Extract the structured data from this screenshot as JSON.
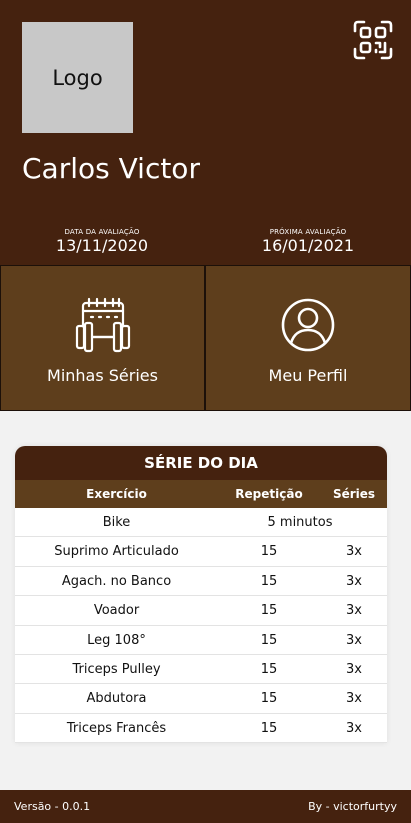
{
  "header": {
    "logo_text": "Logo",
    "user_name": "Carlos Victor",
    "evaluation_date_label": "DATA DA AVALIAÇÃO",
    "evaluation_date": "13/11/2020",
    "next_evaluation_label": "PRÓXIMA AVALIAÇÃO",
    "next_evaluation_date": "16/01/2021",
    "qr_icon": "qr-code-icon"
  },
  "tiles": {
    "series_label": "Minhas Séries",
    "series_icon": "calendar-dumbbell-icon",
    "profile_label": "Meu Perfil",
    "profile_icon": "user-profile-icon"
  },
  "series_card": {
    "title": "SÉRIE DO DIA",
    "columns": [
      "Exercício",
      "Repetição",
      "Séries"
    ],
    "rows": [
      {
        "exercise": "Bike",
        "span": "5 minutos"
      },
      {
        "exercise": "Suprimo Articulado",
        "reps": "15",
        "sets": "3x"
      },
      {
        "exercise": "Agach. no Banco",
        "reps": "15",
        "sets": "3x"
      },
      {
        "exercise": "Voador",
        "reps": "15",
        "sets": "3x"
      },
      {
        "exercise": "Leg 108°",
        "reps": "15",
        "sets": "3x"
      },
      {
        "exercise": "Triceps Pulley",
        "reps": "15",
        "sets": "3x"
      },
      {
        "exercise": "Abdutora",
        "reps": "15",
        "sets": "3x"
      },
      {
        "exercise": "Triceps Francês",
        "reps": "15",
        "sets": "3x"
      }
    ]
  },
  "footer": {
    "version": "Versão - 0.0.1",
    "author": "By - victorfurtyy"
  },
  "colors": {
    "header_bg": "#45220f",
    "tile_bg": "#5e3e1c"
  }
}
